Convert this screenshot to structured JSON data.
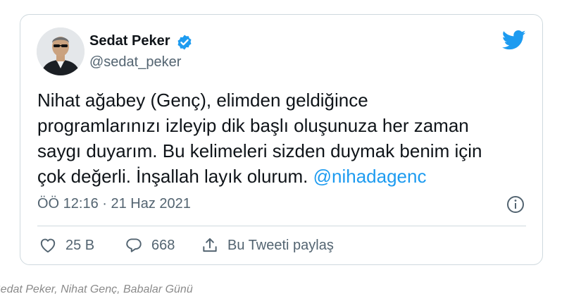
{
  "tweet": {
    "author_name": "Sedat Peker",
    "author_handle": "@sedat_peker",
    "text_lines": [
      "Nihat ağabey (Genç), elimden geldiğince",
      "programlarınızı izleyip dik başlı oluşunuza her zaman",
      "saygı duyarım. Bu kelimeleri sizden duymak benim için",
      "çok değerli. İnşallah layık olurum. "
    ],
    "mention": "@nihadagenc",
    "timestamp": "ÖÖ 12:16 · 21 Haz 2021",
    "actions": {
      "like_count": "25 B",
      "reply_count": "668",
      "share_label": "Bu Tweeti paylaş"
    }
  },
  "caption": "Sedat Peker, Nihat Genç, Babalar Günü",
  "colors": {
    "brand": "#1d9bf0",
    "text": "#0f1419",
    "muted": "#536471",
    "border": "#cfd9de"
  },
  "icons": [
    "verified-badge-icon",
    "twitter-bird-icon",
    "info-icon",
    "heart-icon",
    "reply-bubble-icon",
    "share-icon"
  ]
}
